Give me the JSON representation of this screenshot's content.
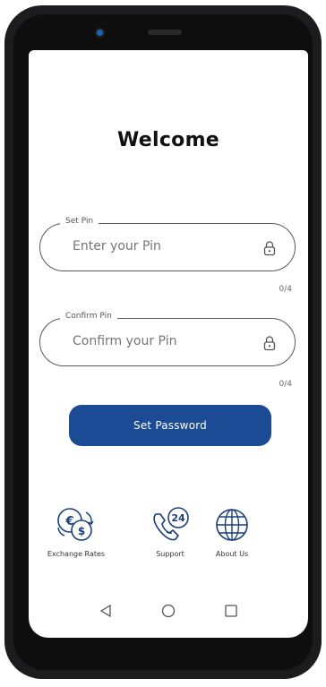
{
  "header": {
    "title": "Welcome"
  },
  "pin": {
    "label": "Set Pin",
    "placeholder": "Enter your Pin",
    "counter": "0/4"
  },
  "confirm": {
    "label": "Confirm Pin",
    "placeholder": "Confirm your Pin",
    "counter": "0/4"
  },
  "submit": {
    "label": "Set Password"
  },
  "shortcuts": [
    {
      "label": "Exchange Rates",
      "icon": "currency-exchange-icon"
    },
    {
      "label": "Support",
      "icon": "support-24-phone-icon"
    },
    {
      "label": "About Us",
      "icon": "globe-icon"
    }
  ],
  "colors": {
    "primary": "#1b4b95",
    "camera": "#1e5fb8"
  }
}
